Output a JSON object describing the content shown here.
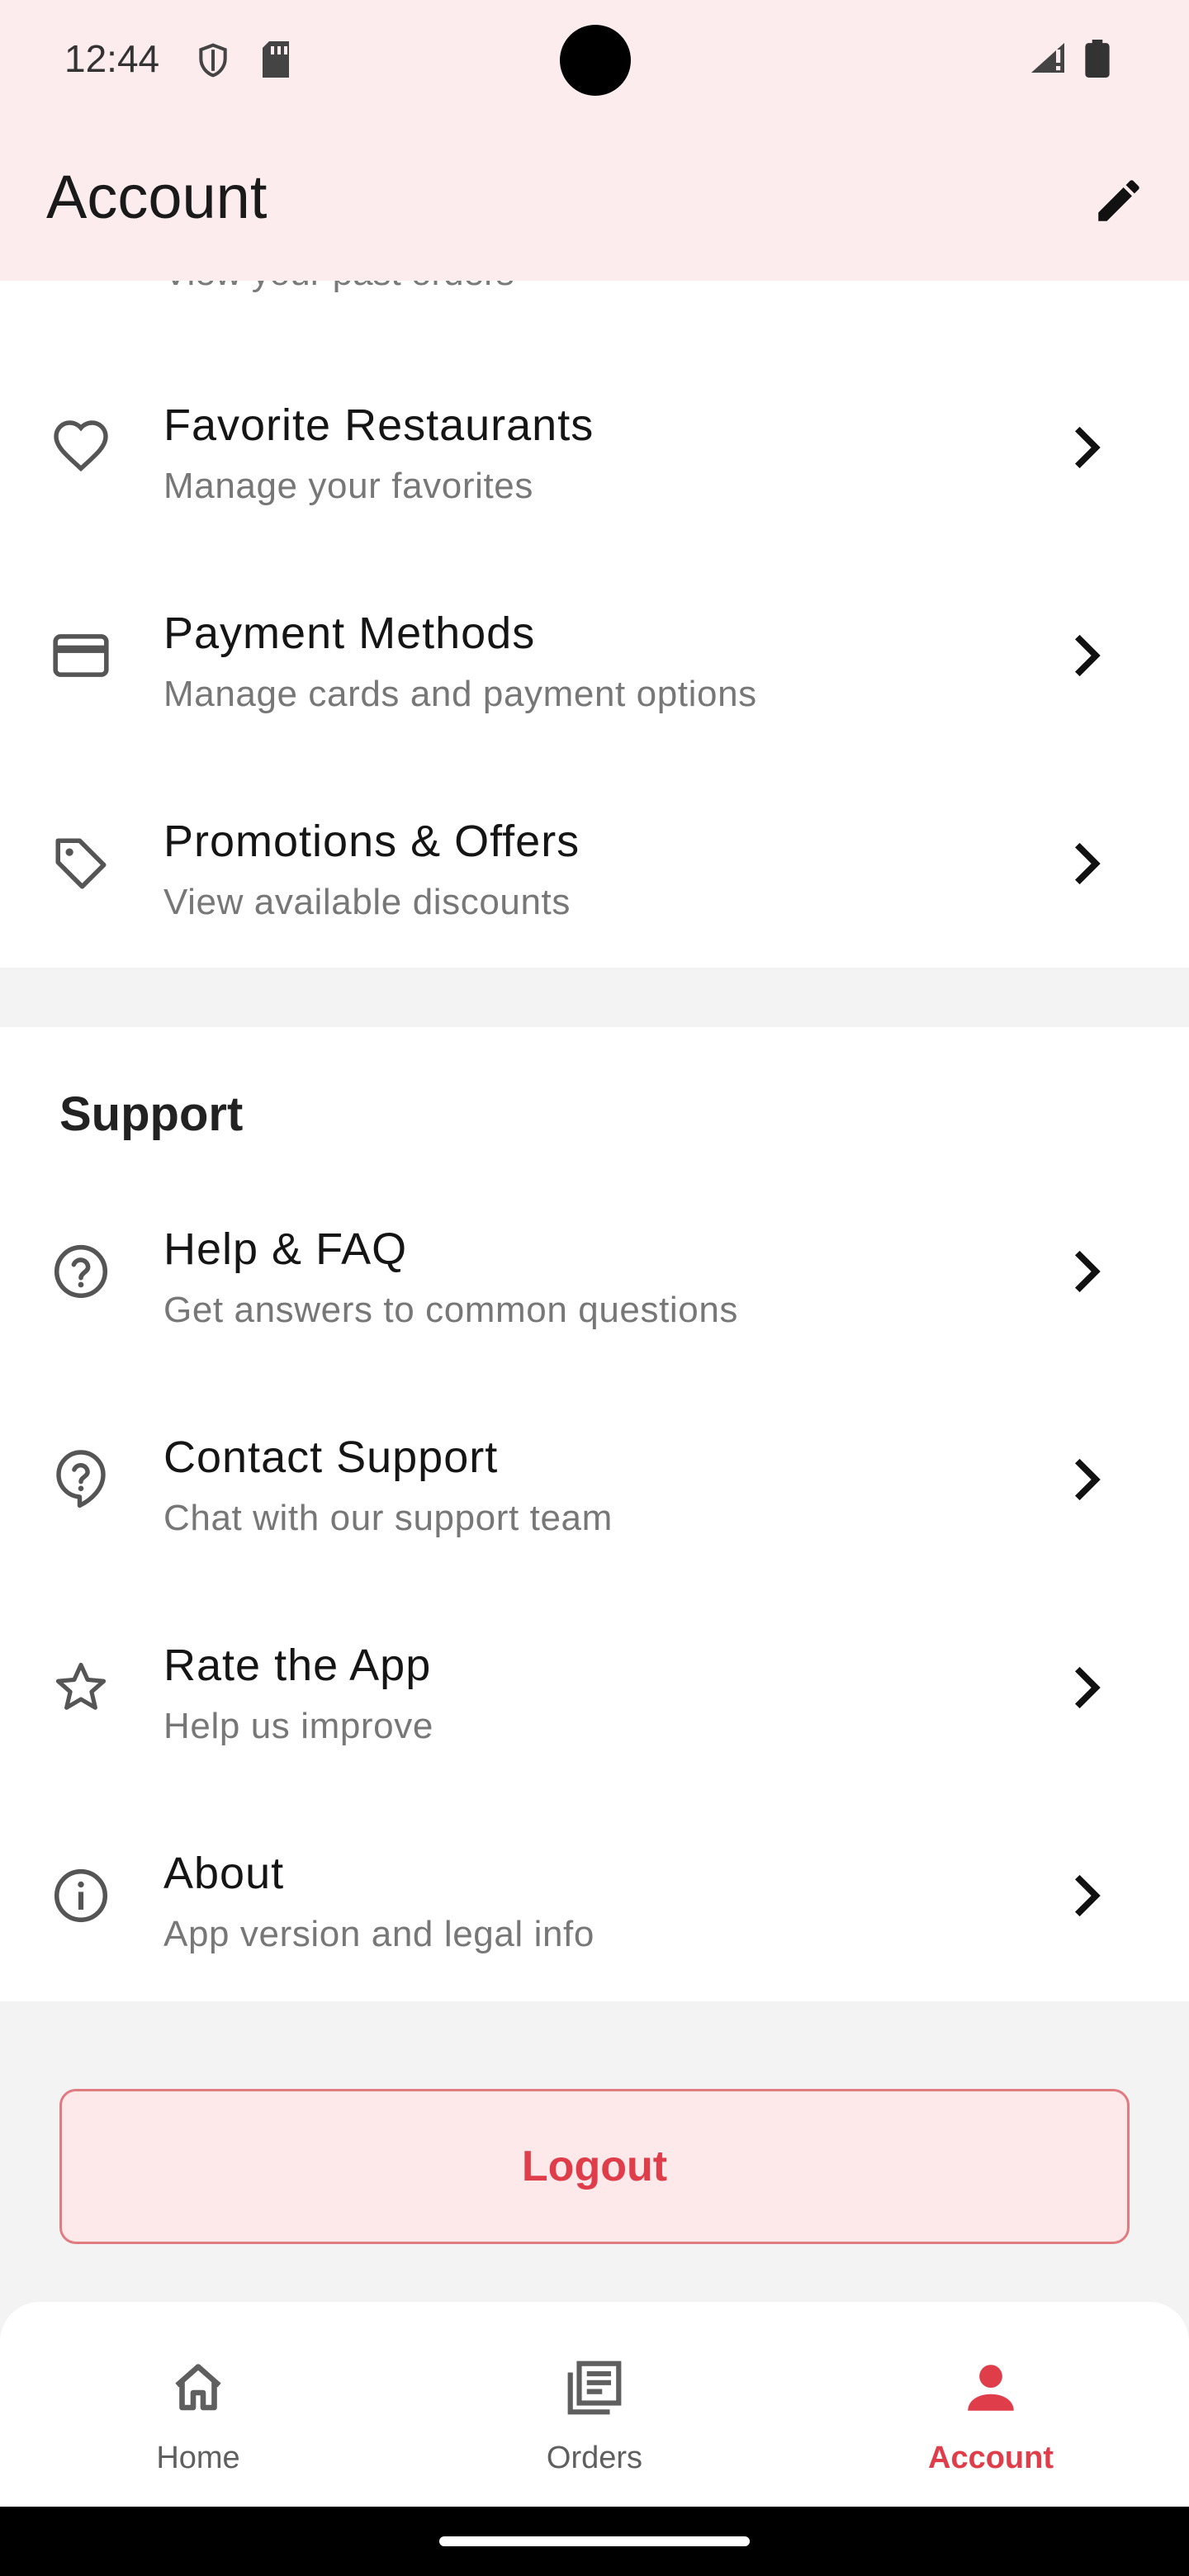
{
  "status_bar": {
    "time": "12:44"
  },
  "app_bar": {
    "title": "Account"
  },
  "partial_item": {
    "subtitle": "View your past orders"
  },
  "account_items": [
    {
      "title": "Favorite Restaurants",
      "subtitle": "Manage your favorites",
      "icon": "heart-icon"
    },
    {
      "title": "Payment Methods",
      "subtitle": "Manage cards and payment options",
      "icon": "credit-card-icon"
    },
    {
      "title": "Promotions & Offers",
      "subtitle": "View available discounts",
      "icon": "tag-icon"
    }
  ],
  "support": {
    "heading": "Support",
    "items": [
      {
        "title": "Help & FAQ",
        "subtitle": "Get answers to common questions",
        "icon": "help-circle-icon"
      },
      {
        "title": "Contact Support",
        "subtitle": "Chat with our support team",
        "icon": "support-bubble-icon"
      },
      {
        "title": "Rate the App",
        "subtitle": "Help us improve",
        "icon": "star-icon"
      },
      {
        "title": "About",
        "subtitle": "App version and legal info",
        "icon": "info-icon"
      }
    ]
  },
  "logout_label": "Logout",
  "bottom_nav": {
    "items": [
      {
        "label": "Home",
        "icon": "home-icon",
        "active": false
      },
      {
        "label": "Orders",
        "icon": "orders-icon",
        "active": false
      },
      {
        "label": "Account",
        "icon": "person-icon",
        "active": true
      }
    ]
  },
  "colors": {
    "accent": "#e03d4a",
    "app_bar_bg": "#fceced",
    "logout_bg": "#fde8ea"
  }
}
